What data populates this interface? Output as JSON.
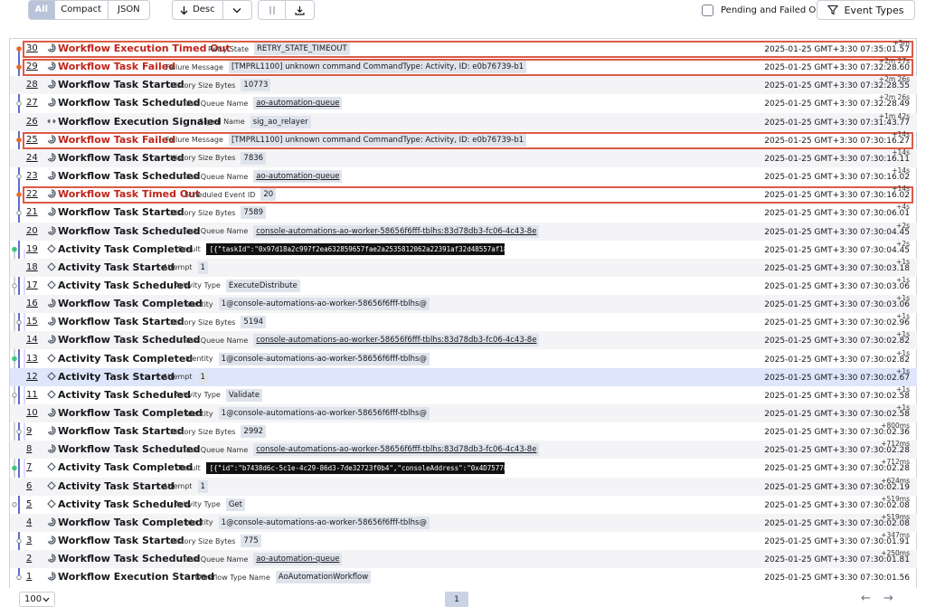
{
  "toolbar": {
    "view_modes": [
      "All",
      "Compact",
      "JSON"
    ],
    "sort_label": "Desc",
    "pending_label": "Pending and Failed Only",
    "event_types_label": "Event Types"
  },
  "colors": {
    "failed": "#c0241a",
    "failed_border": "#dc5b47",
    "rail_blue": "#3b46c5",
    "dot_orange": "#e96a2b",
    "dot_green": "#3cc77a",
    "dot_magenta": "#c23bd6"
  },
  "events": [
    {
      "id": "30",
      "name": "Workflow Execution Timed Out",
      "label": "Retry State",
      "value": "RETRY_STATE_TIMEOUT",
      "delta": "+5m",
      "ts": "2025-01-25 GMT+3:30 07:35:01.57",
      "status": "failed",
      "link": false,
      "code": false,
      "dot": "orange"
    },
    {
      "id": "29",
      "name": "Workflow Task Failed",
      "label": "Failure Message",
      "value": "[TMPRL1100] unknown command CommandType: Activity, ID: e0b76739-b1",
      "delta": "+2m 27s",
      "ts": "2025-01-25 GMT+3:30 07:32:28.60",
      "status": "failed",
      "link": false,
      "code": false,
      "dot": "orange"
    },
    {
      "id": "28",
      "name": "Workflow Task Started",
      "label": "History Size Bytes",
      "value": "10773",
      "delta": "+2m 26s",
      "ts": "2025-01-25 GMT+3:30 07:32:28.55",
      "status": "",
      "link": false,
      "code": false,
      "dot": ""
    },
    {
      "id": "27",
      "name": "Workflow Task Scheduled",
      "label": "Task Queue Name",
      "value": "ao-automation-queue",
      "delta": "+2m 26s",
      "ts": "2025-01-25 GMT+3:30 07:32:28.49",
      "status": "",
      "link": true,
      "code": false,
      "dot": ""
    },
    {
      "id": "26",
      "name": "Workflow Execution Signaled",
      "label": "Signal Name",
      "value": "sig_ao_relayer",
      "delta": "+1m 42s",
      "ts": "2025-01-25 GMT+3:30 07:31:43.77",
      "status": "",
      "link": false,
      "code": false,
      "dot": "magenta"
    },
    {
      "id": "25",
      "name": "Workflow Task Failed",
      "label": "Failure Message",
      "value": "[TMPRL1100] unknown command CommandType: Activity, ID: e0b76739-b1",
      "delta": "+14s",
      "ts": "2025-01-25 GMT+3:30 07:30:16.27",
      "status": "failed",
      "link": false,
      "code": false,
      "dot": "orange"
    },
    {
      "id": "24",
      "name": "Workflow Task Started",
      "label": "History Size Bytes",
      "value": "7836",
      "delta": "+14s",
      "ts": "2025-01-25 GMT+3:30 07:30:16.11",
      "status": "",
      "link": false,
      "code": false,
      "dot": ""
    },
    {
      "id": "23",
      "name": "Workflow Task Scheduled",
      "label": "Task Queue Name",
      "value": "ao-automation-queue",
      "delta": "+14s",
      "ts": "2025-01-25 GMT+3:30 07:30:16.02",
      "status": "",
      "link": true,
      "code": false,
      "dot": ""
    },
    {
      "id": "22",
      "name": "Workflow Task Timed Out",
      "label": "Scheduled Event ID",
      "value": "20",
      "delta": "+14s",
      "ts": "2025-01-25 GMT+3:30 07:30:16.02",
      "status": "failed",
      "link": false,
      "code": false,
      "dot": "orange"
    },
    {
      "id": "21",
      "name": "Workflow Task Started",
      "label": "History Size Bytes",
      "value": "7589",
      "delta": "+4s",
      "ts": "2025-01-25 GMT+3:30 07:30:06.01",
      "status": "",
      "link": false,
      "code": false,
      "dot": ""
    },
    {
      "id": "20",
      "name": "Workflow Task Scheduled",
      "label": "Task Queue Name",
      "value": "console-automations-ao-worker-58656f6fff-tblhs:83d78db3-fc06-4c43-8e",
      "delta": "+2s",
      "ts": "2025-01-25 GMT+3:30 07:30:04.45",
      "status": "",
      "link": true,
      "code": false,
      "dot": ""
    },
    {
      "id": "19",
      "name": "Activity Task Completed",
      "label": "Result",
      "value": "[{\"taskId\":\"0x97d18a2c997f2ea632859657fae2a2535812062a22391af32d48557af18",
      "delta": "+2s",
      "ts": "2025-01-25 GMT+3:30 07:30:04.45",
      "status": "",
      "link": false,
      "code": true,
      "dot": "green"
    },
    {
      "id": "18",
      "name": "Activity Task Started",
      "label": "Attempt",
      "value": "1",
      "delta": "+1s",
      "ts": "2025-01-25 GMT+3:30 07:30:03.18",
      "status": "",
      "link": false,
      "code": false,
      "dot": ""
    },
    {
      "id": "17",
      "name": "Activity Task Scheduled",
      "label": "Activity Type",
      "value": "ExecuteDistribute",
      "delta": "+1s",
      "ts": "2025-01-25 GMT+3:30 07:30:03.06",
      "status": "",
      "link": false,
      "code": false,
      "dot": ""
    },
    {
      "id": "16",
      "name": "Workflow Task Completed",
      "label": "Identity",
      "value": "1@console-automations-ao-worker-58656f6fff-tblhs@",
      "delta": "+1s",
      "ts": "2025-01-25 GMT+3:30 07:30:03.06",
      "status": "",
      "link": false,
      "code": false,
      "dot": "green"
    },
    {
      "id": "15",
      "name": "Workflow Task Started",
      "label": "History Size Bytes",
      "value": "5194",
      "delta": "+1s",
      "ts": "2025-01-25 GMT+3:30 07:30:02.96",
      "status": "",
      "link": false,
      "code": false,
      "dot": ""
    },
    {
      "id": "14",
      "name": "Workflow Task Scheduled",
      "label": "Task Queue Name",
      "value": "console-automations-ao-worker-58656f6fff-tblhs:83d78db3-fc06-4c43-8e",
      "delta": "+1s",
      "ts": "2025-01-25 GMT+3:30 07:30:02.82",
      "status": "",
      "link": true,
      "code": false,
      "dot": ""
    },
    {
      "id": "13",
      "name": "Activity Task Completed",
      "label": "Identity",
      "value": "1@console-automations-ao-worker-58656f6fff-tblhs@",
      "delta": "+1s",
      "ts": "2025-01-25 GMT+3:30 07:30:02.82",
      "status": "",
      "link": false,
      "code": false,
      "dot": "green"
    },
    {
      "id": "12",
      "name": "Activity Task Started",
      "label": "Attempt",
      "value": "1",
      "delta": "+1s",
      "ts": "2025-01-25 GMT+3:30 07:30:02.67",
      "status": "selected",
      "link": false,
      "code": false,
      "dot": ""
    },
    {
      "id": "11",
      "name": "Activity Task Scheduled",
      "label": "Activity Type",
      "value": "Validate",
      "delta": "+1s",
      "ts": "2025-01-25 GMT+3:30 07:30:02.58",
      "status": "",
      "link": false,
      "code": false,
      "dot": ""
    },
    {
      "id": "10",
      "name": "Workflow Task Completed",
      "label": "Identity",
      "value": "1@console-automations-ao-worker-58656f6fff-tblhs@",
      "delta": "+1s",
      "ts": "2025-01-25 GMT+3:30 07:30:02.58",
      "status": "",
      "link": false,
      "code": false,
      "dot": "green"
    },
    {
      "id": "9",
      "name": "Workflow Task Started",
      "label": "History Size Bytes",
      "value": "2992",
      "delta": "+800ms",
      "ts": "2025-01-25 GMT+3:30 07:30:02.36",
      "status": "",
      "link": false,
      "code": false,
      "dot": ""
    },
    {
      "id": "8",
      "name": "Workflow Task Scheduled",
      "label": "Task Queue Name",
      "value": "console-automations-ao-worker-58656f6fff-tblhs:83d78db3-fc06-4c43-8e",
      "delta": "+712ms",
      "ts": "2025-01-25 GMT+3:30 07:30:02.28",
      "status": "",
      "link": true,
      "code": false,
      "dot": ""
    },
    {
      "id": "7",
      "name": "Activity Task Completed",
      "label": "Result",
      "value": "[{\"id\":\"b7438d6c-5c1e-4c29-86d3-7de32723f0b4\",\"consoleAddress\":\"0x4D75778",
      "delta": "+712ms",
      "ts": "2025-01-25 GMT+3:30 07:30:02.28",
      "status": "",
      "link": false,
      "code": true,
      "dot": "green"
    },
    {
      "id": "6",
      "name": "Activity Task Started",
      "label": "Attempt",
      "value": "1",
      "delta": "+624ms",
      "ts": "2025-01-25 GMT+3:30 07:30:02.19",
      "status": "",
      "link": false,
      "code": false,
      "dot": ""
    },
    {
      "id": "5",
      "name": "Activity Task Scheduled",
      "label": "Activity Type",
      "value": "Get",
      "delta": "+519ms",
      "ts": "2025-01-25 GMT+3:30 07:30:02.08",
      "status": "",
      "link": false,
      "code": false,
      "dot": ""
    },
    {
      "id": "4",
      "name": "Workflow Task Completed",
      "label": "Identity",
      "value": "1@console-automations-ao-worker-58656f6fff-tblhs@",
      "delta": "+519ms",
      "ts": "2025-01-25 GMT+3:30 07:30:02.08",
      "status": "",
      "link": false,
      "code": false,
      "dot": "green"
    },
    {
      "id": "3",
      "name": "Workflow Task Started",
      "label": "History Size Bytes",
      "value": "775",
      "delta": "+347ms",
      "ts": "2025-01-25 GMT+3:30 07:30:01.91",
      "status": "",
      "link": false,
      "code": false,
      "dot": ""
    },
    {
      "id": "2",
      "name": "Workflow Task Scheduled",
      "label": "Task Queue Name",
      "value": "ao-automation-queue",
      "delta": "+250ms",
      "ts": "2025-01-25 GMT+3:30 07:30:01.81",
      "status": "",
      "link": true,
      "code": false,
      "dot": ""
    },
    {
      "id": "1",
      "name": "Workflow Execution Started",
      "label": "Workflow Type Name",
      "value": "AoAutomationWorkflow",
      "delta": "",
      "ts": "2025-01-25 GMT+3:30 07:30:01.56",
      "status": "",
      "link": false,
      "code": false,
      "dot": ""
    }
  ],
  "footer": {
    "per_page": "100",
    "page": "1"
  }
}
